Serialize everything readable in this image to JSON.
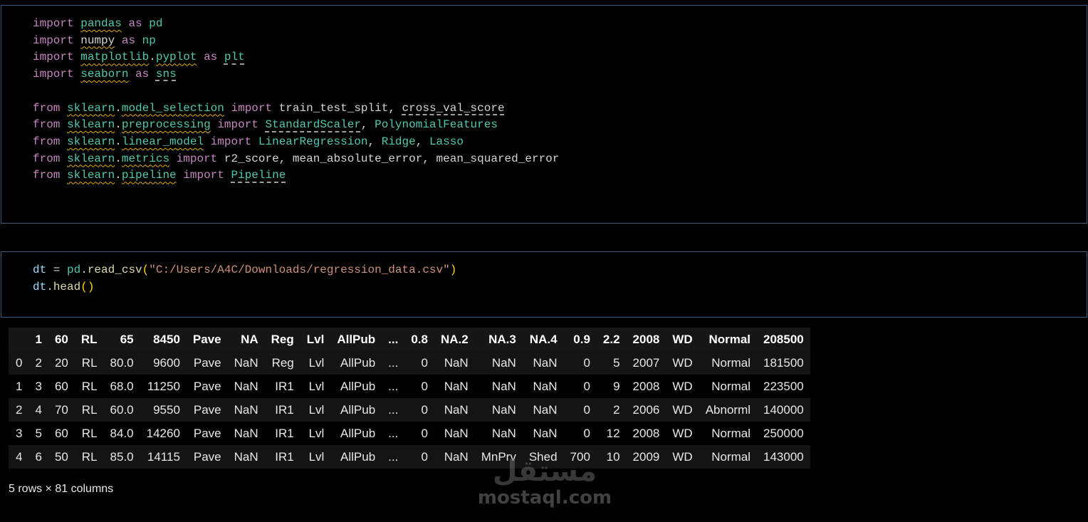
{
  "cells": {
    "imports": {
      "lines": [
        [
          [
            "kw",
            "import"
          ],
          [
            "plain",
            " "
          ],
          [
            "mod warn",
            "pandas"
          ],
          [
            "plain",
            " "
          ],
          [
            "kw",
            "as"
          ],
          [
            "plain",
            " "
          ],
          [
            "al",
            "pd"
          ]
        ],
        [
          [
            "kw",
            "import"
          ],
          [
            "plain",
            " "
          ],
          [
            "plain warn",
            "numpy"
          ],
          [
            "plain",
            " "
          ],
          [
            "kw",
            "as"
          ],
          [
            "plain",
            " "
          ],
          [
            "al",
            "np"
          ]
        ],
        [
          [
            "kw",
            "import"
          ],
          [
            "plain",
            " "
          ],
          [
            "mod warn",
            "matplotlib"
          ],
          [
            "plain",
            "."
          ],
          [
            "mod warn",
            "pyplot"
          ],
          [
            "plain",
            " "
          ],
          [
            "kw",
            "as"
          ],
          [
            "plain",
            " "
          ],
          [
            "al dash",
            "plt"
          ]
        ],
        [
          [
            "kw",
            "import"
          ],
          [
            "plain",
            " "
          ],
          [
            "mod warn",
            "seaborn"
          ],
          [
            "plain",
            " "
          ],
          [
            "kw",
            "as"
          ],
          [
            "plain",
            " "
          ],
          [
            "al dash",
            "sns"
          ]
        ],
        [],
        [
          [
            "kw",
            "from"
          ],
          [
            "plain",
            " "
          ],
          [
            "mod warn",
            "sklearn"
          ],
          [
            "plain",
            "."
          ],
          [
            "mod warn",
            "model_selection"
          ],
          [
            "plain",
            " "
          ],
          [
            "kw",
            "import"
          ],
          [
            "plain",
            " "
          ],
          [
            "plain",
            "train_test_split, "
          ],
          [
            "plain dash",
            "cross_val_score"
          ]
        ],
        [
          [
            "kw",
            "from"
          ],
          [
            "plain",
            " "
          ],
          [
            "mod warn",
            "sklearn"
          ],
          [
            "plain",
            "."
          ],
          [
            "mod warn",
            "preprocessing"
          ],
          [
            "plain",
            " "
          ],
          [
            "kw",
            "import"
          ],
          [
            "plain",
            " "
          ],
          [
            "cls dash",
            "StandardScaler"
          ],
          [
            "plain",
            ", "
          ],
          [
            "cls",
            "PolynomialFeatures"
          ]
        ],
        [
          [
            "kw",
            "from"
          ],
          [
            "plain",
            " "
          ],
          [
            "mod warn",
            "sklearn"
          ],
          [
            "plain",
            "."
          ],
          [
            "mod warn",
            "linear_model"
          ],
          [
            "plain",
            " "
          ],
          [
            "kw",
            "import"
          ],
          [
            "plain",
            " "
          ],
          [
            "cls",
            "LinearRegression"
          ],
          [
            "plain",
            ", "
          ],
          [
            "cls",
            "Ridge"
          ],
          [
            "plain",
            ", "
          ],
          [
            "cls",
            "Lasso"
          ]
        ],
        [
          [
            "kw",
            "from"
          ],
          [
            "plain",
            " "
          ],
          [
            "mod warn",
            "sklearn"
          ],
          [
            "plain",
            "."
          ],
          [
            "mod warn",
            "metrics"
          ],
          [
            "plain",
            " "
          ],
          [
            "kw",
            "import"
          ],
          [
            "plain",
            " "
          ],
          [
            "plain",
            "r2_score, mean_absolute_error, mean_squared_error"
          ]
        ],
        [
          [
            "kw",
            "from"
          ],
          [
            "plain",
            " "
          ],
          [
            "mod warn",
            "sklearn"
          ],
          [
            "plain",
            "."
          ],
          [
            "mod warn",
            "pipeline"
          ],
          [
            "plain",
            " "
          ],
          [
            "kw",
            "import"
          ],
          [
            "plain",
            " "
          ],
          [
            "cls dash",
            "Pipeline"
          ]
        ]
      ]
    },
    "read": {
      "lines": [
        [
          [
            "var",
            "dt"
          ],
          [
            "plain",
            " = "
          ],
          [
            "al",
            "pd"
          ],
          [
            "plain",
            "."
          ],
          [
            "fn",
            "read_csv"
          ],
          [
            "par",
            "("
          ],
          [
            "str",
            "\"C:/Users/A4C/Downloads/regression_data.csv\""
          ],
          [
            "par",
            ")"
          ]
        ],
        [
          [
            "var",
            "dt"
          ],
          [
            "plain",
            "."
          ],
          [
            "fn",
            "head"
          ],
          [
            "par",
            "()"
          ]
        ]
      ]
    }
  },
  "table": {
    "columns": [
      "",
      "1",
      "60",
      "RL",
      "65",
      "8450",
      "Pave",
      "NA",
      "Reg",
      "Lvl",
      "AllPub",
      "...",
      "0.8",
      "NA.2",
      "NA.3",
      "NA.4",
      "0.9",
      "2.2",
      "2008",
      "WD",
      "Normal",
      "208500"
    ],
    "rows": [
      [
        "0",
        "2",
        "20",
        "RL",
        "80.0",
        "9600",
        "Pave",
        "NaN",
        "Reg",
        "Lvl",
        "AllPub",
        "...",
        "0",
        "NaN",
        "NaN",
        "NaN",
        "0",
        "5",
        "2007",
        "WD",
        "Normal",
        "181500"
      ],
      [
        "1",
        "3",
        "60",
        "RL",
        "68.0",
        "11250",
        "Pave",
        "NaN",
        "IR1",
        "Lvl",
        "AllPub",
        "...",
        "0",
        "NaN",
        "NaN",
        "NaN",
        "0",
        "9",
        "2008",
        "WD",
        "Normal",
        "223500"
      ],
      [
        "2",
        "4",
        "70",
        "RL",
        "60.0",
        "9550",
        "Pave",
        "NaN",
        "IR1",
        "Lvl",
        "AllPub",
        "...",
        "0",
        "NaN",
        "NaN",
        "NaN",
        "0",
        "2",
        "2006",
        "WD",
        "Abnorml",
        "140000"
      ],
      [
        "3",
        "5",
        "60",
        "RL",
        "84.0",
        "14260",
        "Pave",
        "NaN",
        "IR1",
        "Lvl",
        "AllPub",
        "...",
        "0",
        "NaN",
        "NaN",
        "NaN",
        "0",
        "12",
        "2008",
        "WD",
        "Normal",
        "250000"
      ],
      [
        "4",
        "6",
        "50",
        "RL",
        "85.0",
        "14115",
        "Pave",
        "NaN",
        "IR1",
        "Lvl",
        "AllPub",
        "...",
        "0",
        "NaN",
        "MnPrv",
        "Shed",
        "700",
        "10",
        "2009",
        "WD",
        "Normal",
        "143000"
      ]
    ]
  },
  "shape_note": "5 rows × 81 columns",
  "watermark": {
    "arabic": "مستقل",
    "latin": "mostaql.com"
  }
}
